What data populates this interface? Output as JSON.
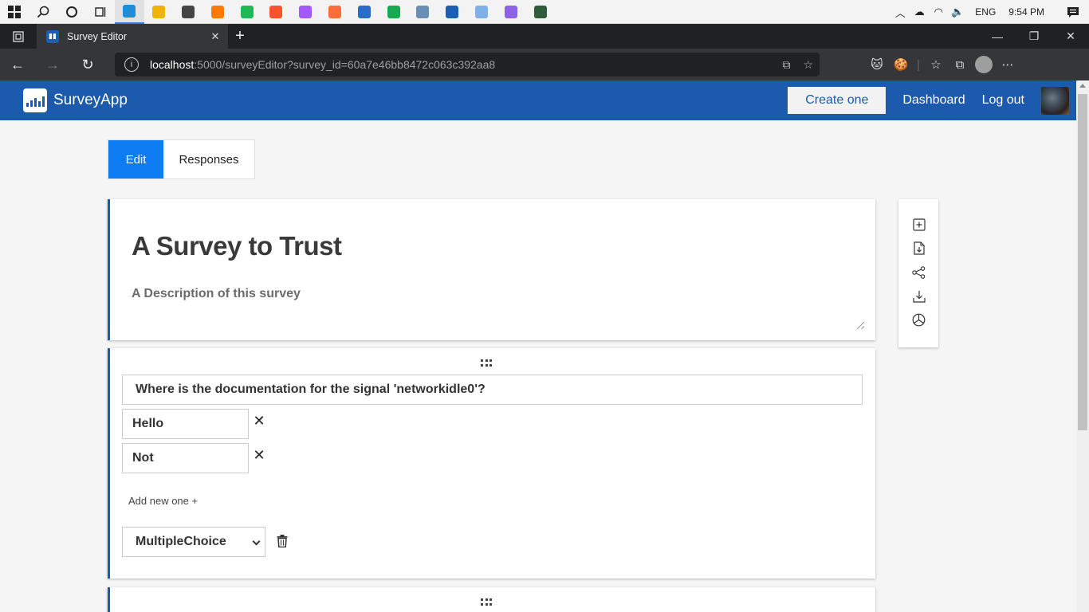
{
  "taskbar": {
    "apps": [
      {
        "name": "edge-app",
        "color": "#1d8dd6",
        "active": true
      },
      {
        "name": "file-explorer-app",
        "color": "#f0b400"
      },
      {
        "name": "store-app",
        "color": "#444444"
      },
      {
        "name": "sublime-app",
        "color": "#ff7a00"
      },
      {
        "name": "spotify-app",
        "color": "#1db954"
      },
      {
        "name": "brave-app",
        "color": "#fb542b"
      },
      {
        "name": "figma-app",
        "color": "#a259ff"
      },
      {
        "name": "postman-app",
        "color": "#ff6c37"
      },
      {
        "name": "powershell-app",
        "color": "#2a6cc9"
      },
      {
        "name": "mongodb-app",
        "color": "#13aa52"
      },
      {
        "name": "resource-monitor-app",
        "color": "#6a8fb5"
      },
      {
        "name": "surveyapp-pwa",
        "color": "#1a5fb4"
      },
      {
        "name": "cortana-app",
        "color": "#7fb0e8"
      },
      {
        "name": "visual-studio-app",
        "color": "#8d63e8"
      },
      {
        "name": "gitkraken-app",
        "color": "#2f5d3b"
      }
    ],
    "language": "ENG",
    "time": "9:54 PM"
  },
  "browser": {
    "tab_title": "Survey Editor",
    "url_host": "localhost",
    "url_rest": ":5000/surveyEditor?survey_id=60a7e46bb8472c063c392aa8"
  },
  "header": {
    "brand": "SurveyApp",
    "create_label": "Create one",
    "dashboard_label": "Dashboard",
    "logout_label": "Log out"
  },
  "editor": {
    "tabs": [
      "Edit",
      "Responses"
    ],
    "active_tab": "Edit",
    "survey_title": "A Survey to Trust",
    "survey_description": "A Description of this survey",
    "questions": [
      {
        "text": "Where is the documentation for the signal 'networkidle0'?",
        "options": [
          "Hello",
          "Not"
        ],
        "add_label": "Add new one +",
        "type": "MultipleChoice"
      }
    ]
  },
  "toolbox": {
    "tools": [
      "add-question-icon",
      "import-file-icon",
      "share-icon",
      "download-icon",
      "stats-pie-icon"
    ]
  },
  "colors": {
    "header_bg": "#1b5aad",
    "active_tab": "#0d7cf2",
    "page_bg": "#f5f5f5"
  }
}
